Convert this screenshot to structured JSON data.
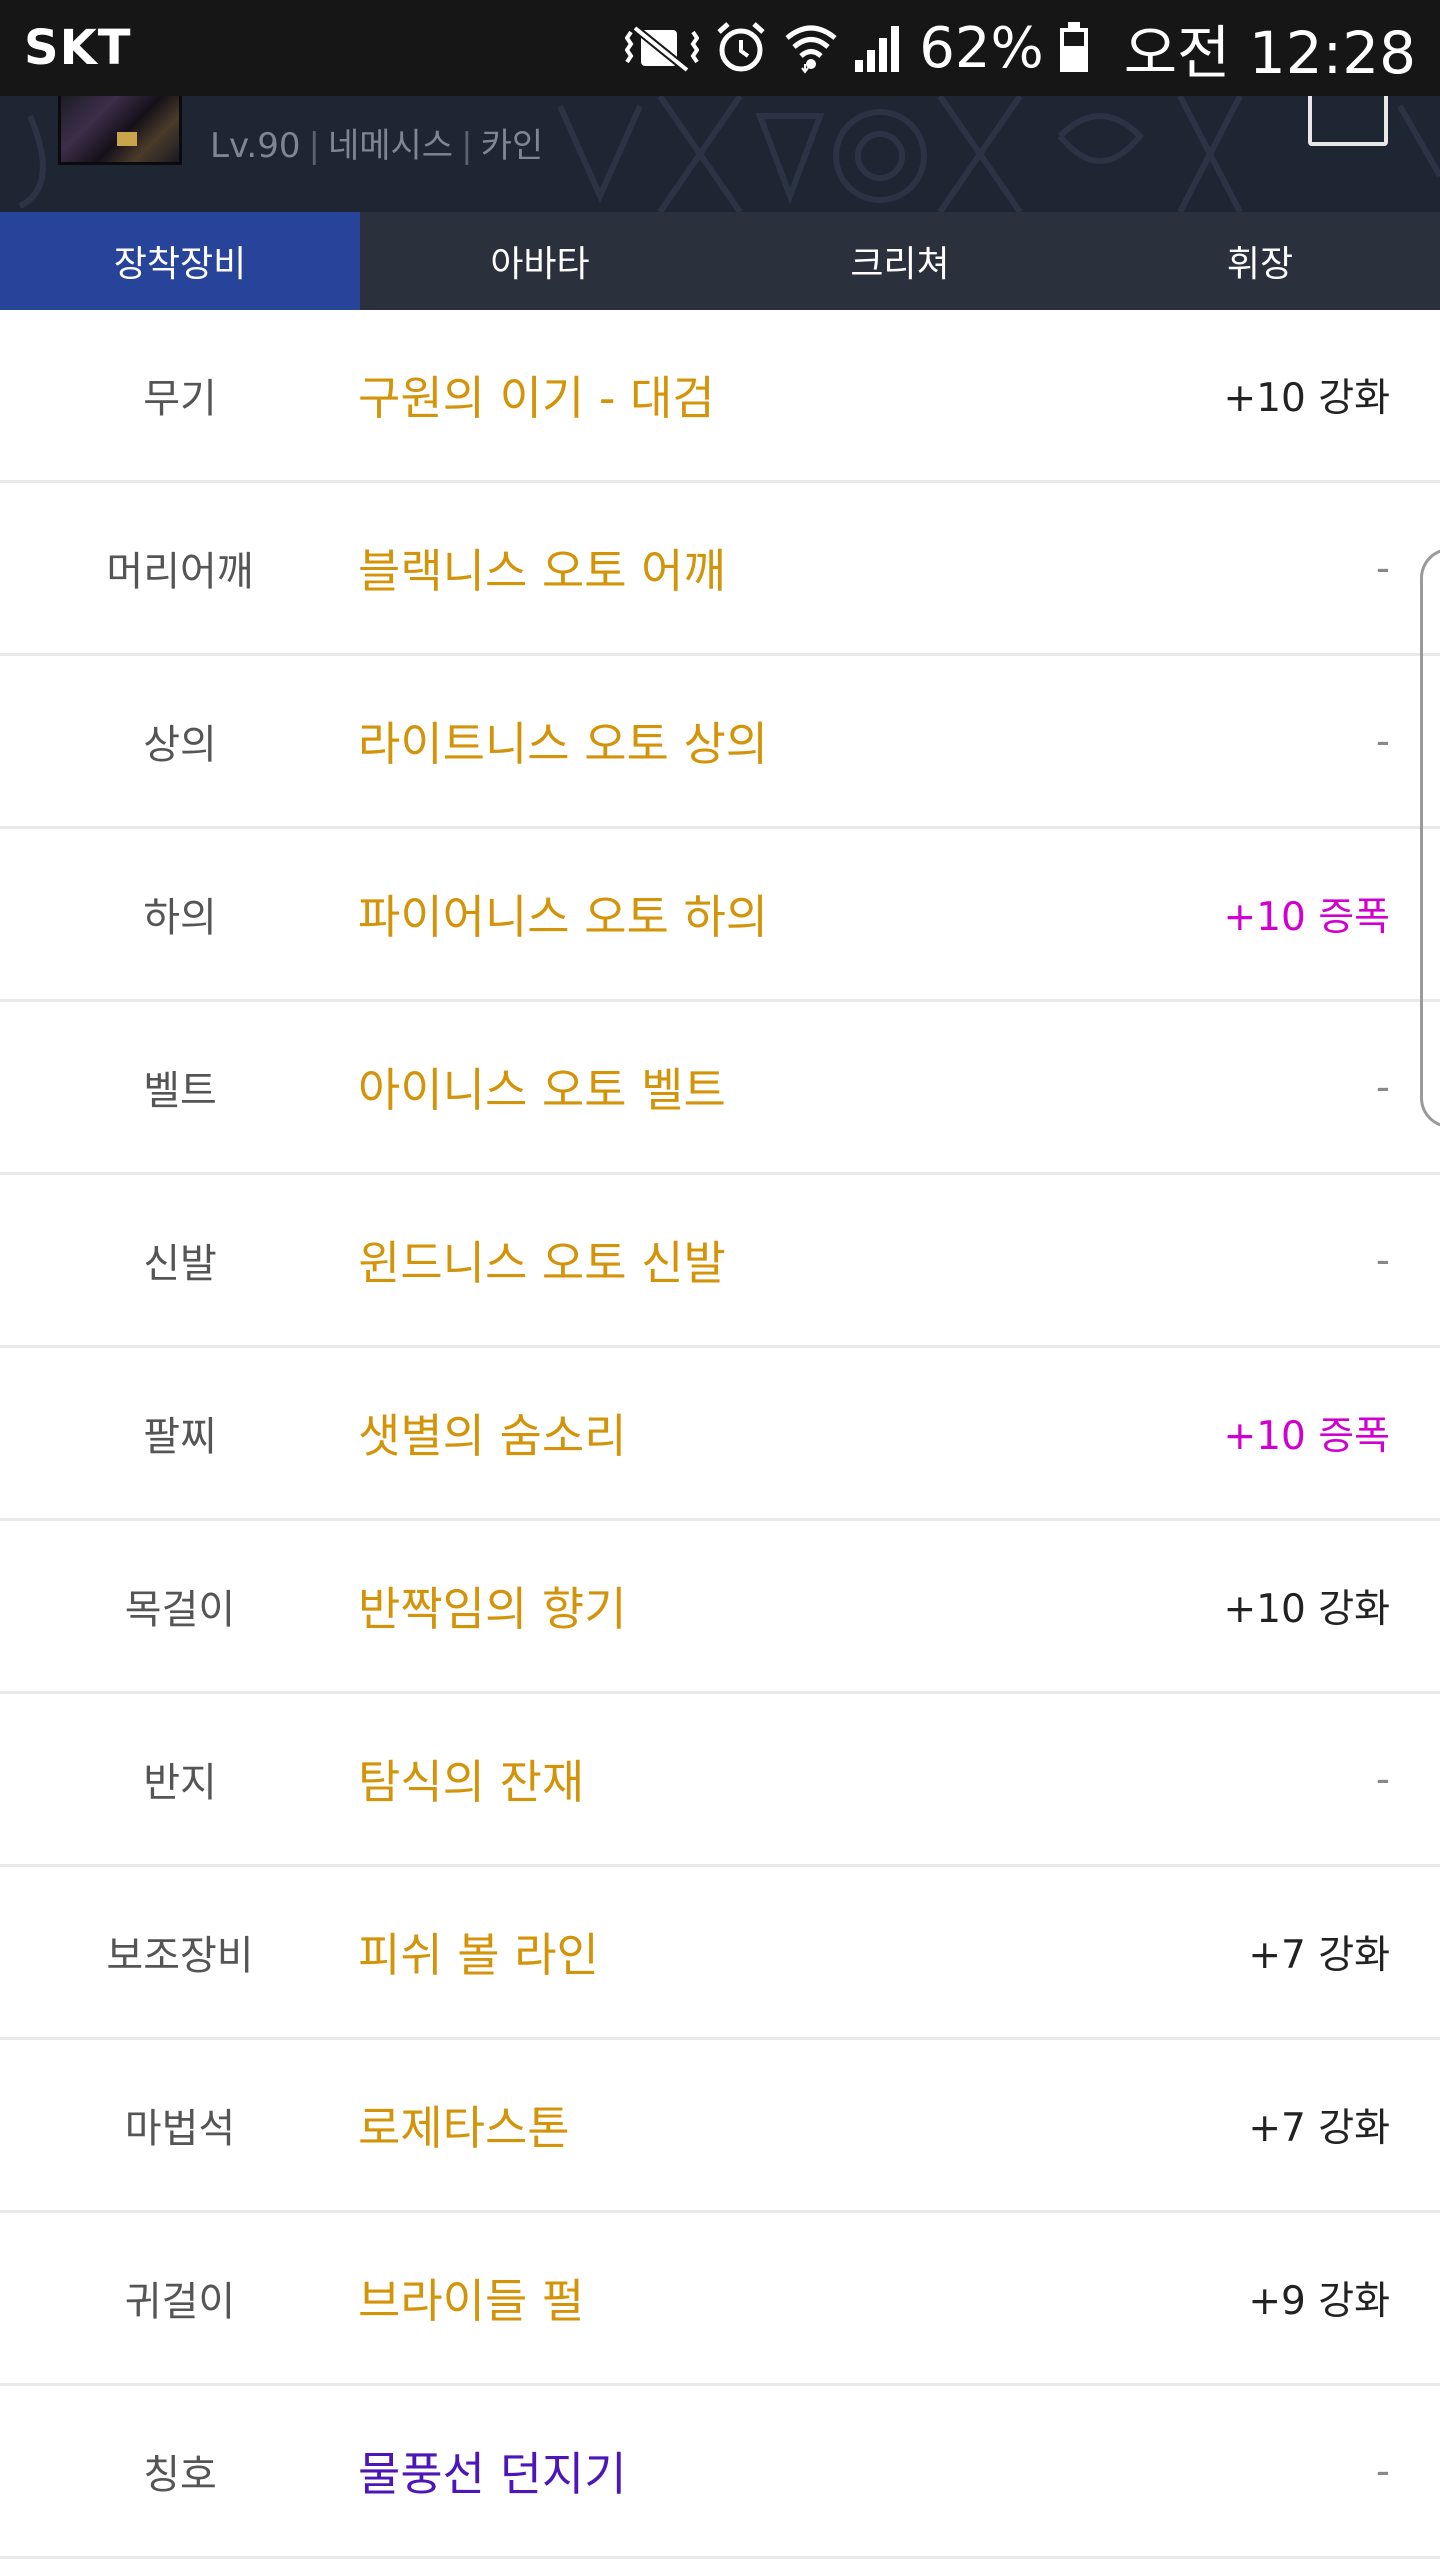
{
  "status_bar": {
    "carrier": "SKT",
    "battery": "62%",
    "time": "오전 12:28",
    "icons": [
      "vibrate-mute-icon",
      "alarm-icon",
      "wifi-icon",
      "signal-icon",
      "battery-icon"
    ]
  },
  "character": {
    "name": "",
    "level": "Lv.90",
    "server": "네메시스",
    "class": "카인"
  },
  "tabs": [
    {
      "label": "장착장비",
      "active": true
    },
    {
      "label": "아바타",
      "active": false
    },
    {
      "label": "크리쳐",
      "active": false
    },
    {
      "label": "휘장",
      "active": false
    }
  ],
  "equipment": [
    {
      "slot": "무기",
      "item": "구원의 이기 - 대검",
      "enhance": "+10 강화",
      "item_color": "gold",
      "enhance_style": "normal"
    },
    {
      "slot": "머리어깨",
      "item": "블랙니스 오토 어깨",
      "enhance": "-",
      "item_color": "gold",
      "enhance_style": "dash"
    },
    {
      "slot": "상의",
      "item": "라이트니스 오토 상의",
      "enhance": "-",
      "item_color": "gold",
      "enhance_style": "dash"
    },
    {
      "slot": "하의",
      "item": "파이어니스 오토 하의",
      "enhance": "+10 증폭",
      "item_color": "gold",
      "enhance_style": "magenta"
    },
    {
      "slot": "벨트",
      "item": "아이니스 오토 벨트",
      "enhance": "-",
      "item_color": "gold",
      "enhance_style": "dash"
    },
    {
      "slot": "신발",
      "item": "윈드니스 오토 신발",
      "enhance": "-",
      "item_color": "gold",
      "enhance_style": "dash"
    },
    {
      "slot": "팔찌",
      "item": "샛별의 숨소리",
      "enhance": "+10 증폭",
      "item_color": "gold",
      "enhance_style": "magenta"
    },
    {
      "slot": "목걸이",
      "item": "반짝임의 향기",
      "enhance": "+10 강화",
      "item_color": "gold",
      "enhance_style": "normal"
    },
    {
      "slot": "반지",
      "item": "탐식의 잔재",
      "enhance": "-",
      "item_color": "gold",
      "enhance_style": "dash"
    },
    {
      "slot": "보조장비",
      "item": "피쉬 볼 라인",
      "enhance": "+7 강화",
      "item_color": "gold",
      "enhance_style": "normal"
    },
    {
      "slot": "마법석",
      "item": "로제타스톤",
      "enhance": "+7 강화",
      "item_color": "gold",
      "enhance_style": "normal"
    },
    {
      "slot": "귀걸이",
      "item": "브라이들 펄",
      "enhance": "+9 강화",
      "item_color": "gold",
      "enhance_style": "normal"
    },
    {
      "slot": "칭호",
      "item": "물풍선 던지기",
      "enhance": "-",
      "item_color": "purple",
      "enhance_style": "dash"
    }
  ],
  "colors": {
    "tab_active": "#27439a",
    "tab_bg": "#2a303c",
    "item_gold": "#d4940a",
    "item_purple": "#4d16b8",
    "amplify_magenta": "#d100d1"
  }
}
